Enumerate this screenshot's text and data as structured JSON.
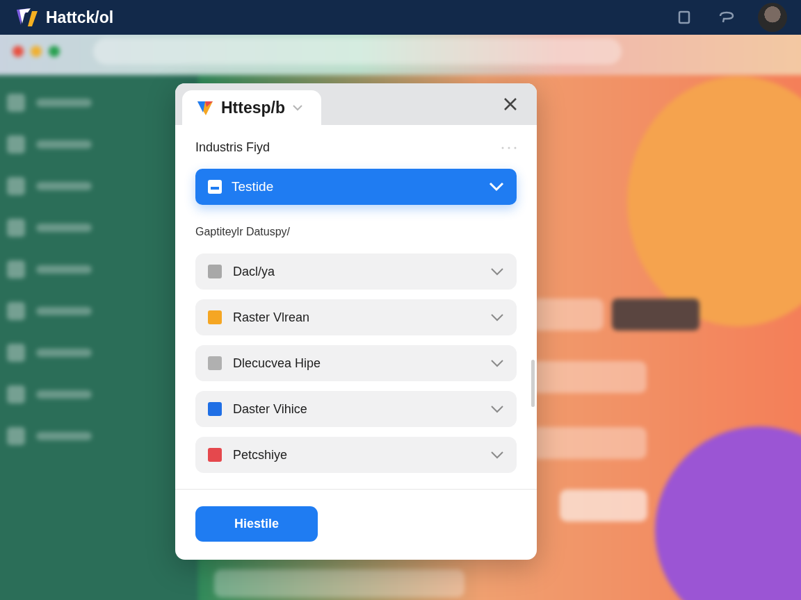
{
  "app": {
    "title": "Hattck/ol"
  },
  "dialog": {
    "tab_title": "Httesp/b",
    "section_label": "Industris Fiyd",
    "selected_option": "Testide",
    "subheading": "Gaptiteylr Datuspy/",
    "items": [
      {
        "label": "Dacl/ya",
        "color": "#a8a8a8"
      },
      {
        "label": "Raster Vlrean",
        "color": "#f5a623"
      },
      {
        "label": "Dlecucvea Hipe",
        "color": "#b0b0b0"
      },
      {
        "label": "Daster Vihice",
        "color": "#1f6fe5"
      },
      {
        "label": "Petcshiye",
        "color": "#e5484d"
      }
    ],
    "primary_button": "Hiestile"
  }
}
